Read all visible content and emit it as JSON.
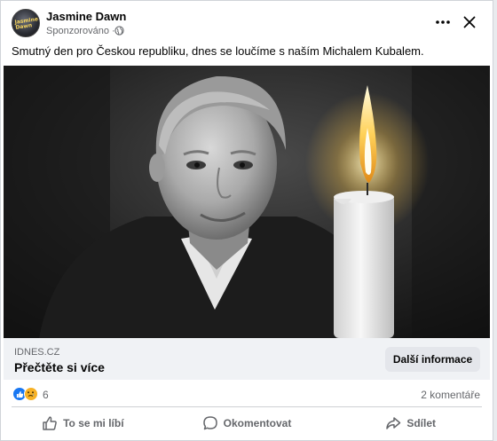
{
  "post": {
    "author": "Jasmine Dawn",
    "avatar_text": "Jasmine Dawn",
    "sponsored_label": "Sponzorováno ·",
    "caption": "Smutný den pro Českou republiku, dnes se loučíme s naším Michalem Kubalem."
  },
  "link": {
    "domain": "IDNES.CZ",
    "title": "Přečtěte si více",
    "cta": "Další informace"
  },
  "stats": {
    "reactions": "6",
    "comments": "2 komentáře"
  },
  "actions": {
    "like": "To se mi líbí",
    "comment": "Okomentovat",
    "share": "Sdílet"
  },
  "icons": {
    "more": "more-horizontal-icon",
    "close": "close-icon",
    "globe": "globe-icon",
    "like_reaction": "thumbs-up-reaction-icon",
    "sad_reaction": "sad-reaction-icon"
  },
  "colors": {
    "brand_blue": "#1877f2",
    "sad_yellow": "#f7b125",
    "muted_text": "#65676b",
    "link_bg": "#f0f2f5"
  }
}
